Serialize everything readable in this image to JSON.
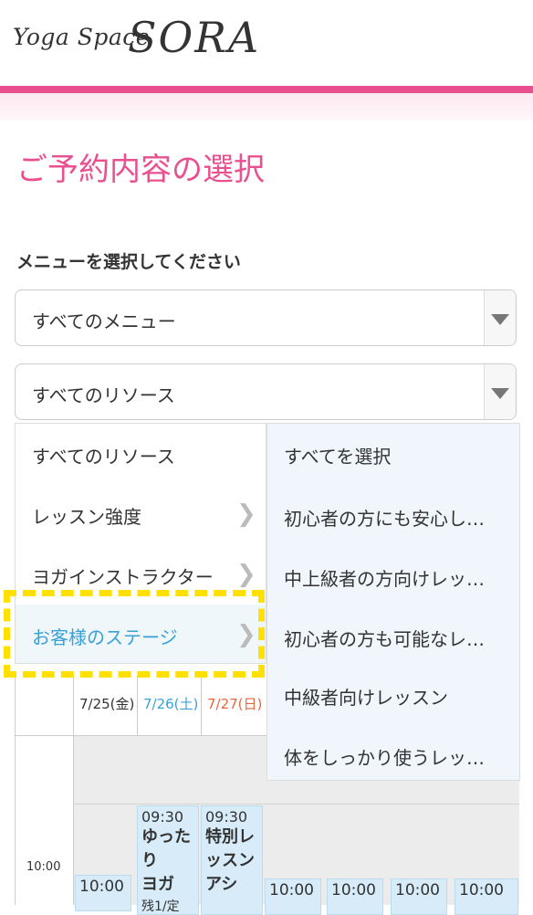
{
  "brand": {
    "name_small": "Yoga Space",
    "name_big": "SORA"
  },
  "page_title": "ご予約内容の選択",
  "section_label": "メニューを選択してください",
  "menu_select": {
    "value": "すべてのメニュー"
  },
  "resource_select": {
    "value": "すべてのリソース"
  },
  "resource_menu": {
    "categories": [
      {
        "label": "すべてのリソース",
        "has_submenu": false,
        "active": false
      },
      {
        "label": "レッスン強度",
        "has_submenu": true,
        "active": false
      },
      {
        "label": "ヨガインストラクター",
        "has_submenu": true,
        "active": false
      },
      {
        "label": "お客様のステージ",
        "has_submenu": true,
        "active": true
      }
    ],
    "options": [
      "すべてを選択",
      "初心者の方にも安心し…",
      "中上級者の方向けレッ…",
      "初心者の方も可能なレ…",
      "中級者向けレッスン",
      "体をしっかり使うレッ…"
    ]
  },
  "calendar": {
    "days": [
      {
        "label": "7/25(金)",
        "color": "#333333"
      },
      {
        "label": "7/26(土)",
        "color": "#3aa0d8"
      },
      {
        "label": "7/27(日)",
        "color": "#e8663c"
      }
    ],
    "row_time": "10:00",
    "lessons": [
      {
        "time": "09:30",
        "name_line1": "ゆったり",
        "name_line2": "ヨガ",
        "remain": "残1/定"
      },
      {
        "time": "09:30",
        "name_line1": "特別レッスン",
        "name_line2": "アシ",
        "remain": ""
      }
    ],
    "slots": [
      "10:00",
      "10:00",
      "10:00",
      "10:00",
      "10:00"
    ]
  },
  "colors": {
    "accent_pink": "#e8508f",
    "highlight": "#ffe000",
    "lesson_bg": "#d7ecf8"
  }
}
